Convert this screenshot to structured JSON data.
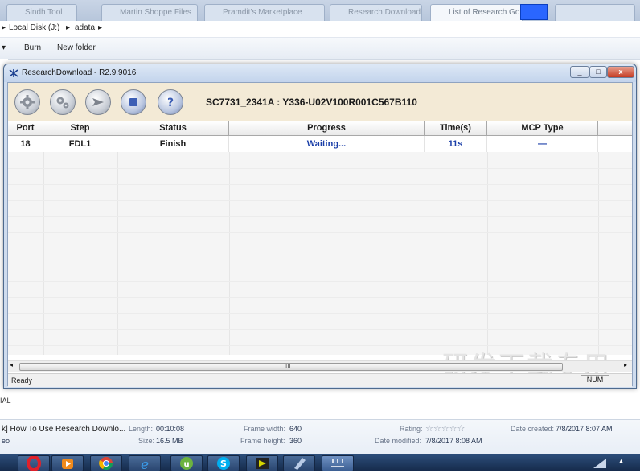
{
  "browser": {
    "tabs": [
      "Sindh Tool",
      "Martin Shoppe Files",
      "Pramdit's Marketplace",
      "Research Download",
      "List of Research Go"
    ]
  },
  "explorer": {
    "breadcrumb": [
      "Local Disk (J:)",
      "adata"
    ],
    "toolbar": {
      "burn": "Burn",
      "new_folder": "New folder"
    },
    "left_fragment": "IAL"
  },
  "details_pane": {
    "file_title": "k] How To Use Research Downlo...",
    "file_type": "eo",
    "length_label": "Length:",
    "length": "00:10:08",
    "size_label": "Size:",
    "size": "16.5 MB",
    "frame_width_label": "Frame width:",
    "frame_width": "640",
    "frame_height_label": "Frame height:",
    "frame_height": "360",
    "rating_label": "Rating:",
    "rating_stars": "☆☆☆☆☆",
    "date_modified_label": "Date modified:",
    "date_modified": "7/8/2017 8:08 AM",
    "date_created_label": "Date created:",
    "date_created": "7/8/2017 8:07 AM"
  },
  "dialog": {
    "title": "ResearchDownload - R2.9.9016",
    "window_controls": {
      "minimize": "_",
      "maximize": "□",
      "close": "x"
    },
    "device_label": "SC7731_2341A : Y336-U02V100R001C567B110",
    "columns": [
      "Port",
      "Step",
      "Status",
      "Progress",
      "Time(s)",
      "MCP Type"
    ],
    "rows": [
      {
        "port": "18",
        "step": "FDL1",
        "status": "Finish",
        "progress": "Waiting...",
        "time": "11s",
        "mcp": "—"
      }
    ],
    "watermark": "研发下载专用",
    "scroll_marker": "III",
    "status_text": "Ready",
    "num_indicator": "NUM"
  },
  "colors": {
    "toolbar_bg": "#f3ead6",
    "highlight_blue": "#2a66ff",
    "progress_text": "#1a3ea8"
  }
}
